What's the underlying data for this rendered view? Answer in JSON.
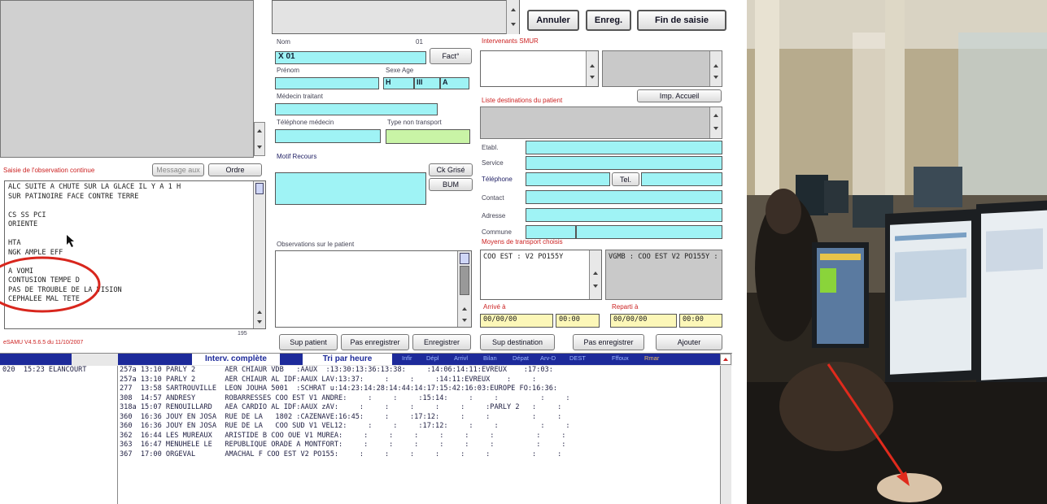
{
  "top_buttons": {
    "cancel": "Annuler",
    "save": "Enreg.",
    "end": "Fin de saisie"
  },
  "patient": {
    "nom_label": "Nom",
    "nom_num": "01",
    "nom_value": "X 01",
    "fact_btn": "Fact°",
    "prenom_label": "Prénom",
    "sexe_age_label": "Sexe Age",
    "sexe": "H",
    "age": "III",
    "age_unit": "A",
    "medecin_label": "Médecin traitant",
    "tel_medecin_label": "Téléphone médecin",
    "transport_label": "Type non transport",
    "motif_label": "Motif Recours",
    "ck_btn": "Ck Grisé",
    "bum_btn": "BUM",
    "obs_label": "Observations sur le patient"
  },
  "observation": {
    "title": "Saisie de l'observation continue",
    "btn_message": "Message aux",
    "btn_ordre": "Ordre",
    "lines": [
      "ALC SUITE A CHUTE SUR LA GLACE IL Y A 1 H",
      "SUR PATINOIRE FACE CONTRE TERRE",
      "",
      "CS SS PCI",
      "ORIENTE",
      "",
      "HTA",
      "NGK AMPLE EFF",
      "",
      "A VOMI",
      "CONTUSION TEMPE D",
      "PAS DE TROUBLE DE LA VISION",
      "CEPHALEE MAL TETE"
    ],
    "counter": "195",
    "version": "eSAMU V4.5.6.5 du 11/10/2007"
  },
  "intervenants": {
    "title": "Intervenants SMUR",
    "dest_title": "Liste destinations du patient",
    "imp_btn": "Imp. Accueil",
    "etabl": "Etabl.",
    "service": "Service",
    "telephone": "Téléphone",
    "tel_btn": "Tel.",
    "contact": "Contact",
    "adresse": "Adresse",
    "commune": "Commune",
    "moyens_title": "Moyens de transport choisis",
    "moyen1": "COO EST : V2 PO155Y",
    "moyen2": "VGMB : COO EST V2 PO155Y :",
    "arrive_label": "Arrivé à",
    "reparti_label": "Reparti à",
    "date1": "00/00/00",
    "time1": "00:00",
    "date2": "00/00/00",
    "time2": "00:00"
  },
  "bottom_buttons": {
    "sup_patient": "Sup patient",
    "pas_enreg": "Pas enregistrer",
    "enreg": "Enregistrer",
    "sup_dest": "Sup destination",
    "pas_enreg2": "Pas enregistrer",
    "ajouter": "Ajouter"
  },
  "table": {
    "tab1": "Interv. complète",
    "tab2": "Tri par heure",
    "headers": [
      "Infir",
      "Dépl",
      "Arrivl",
      "Bilan",
      "Dépat",
      "Arv-D",
      "DEST",
      "Fffoux",
      "Rmar"
    ],
    "left_row": "020  15:23 ELANCOURT",
    "rows": [
      "257a 13:10 PARLY 2       AER CHIAUR VDB   :AAUX  :13:30:13:36:13:38:     :14:06:14:11:EVREUX    :17:03:",
      "257a 13:10 PARLY 2       AER CHIAUR AL IDF:AAUX LAV:13:37:     :     :     :14:11:EVREUX    :     :",
      "277  13:58 SARTROUVILLE  LEON JOUHA 5001  :SCHRAT u:14:23:14:28:14:44:14:17:15:42:16:03:EUROPE FO:16:36:",
      "308  14:57 ANDRESY       ROBARRESSES COO EST V1 ANDRE:     :     :     :15:14:     :     :          :     :",
      "318a 15:07 RENOUILLARD   AEA CARDIO AL IDF:AAUX zAV:     :     :     :     :     :     :PARLY 2   :     :",
      "360  16:36 JOUY EN JOSA  RUE DE LA   1802 :CAZENAVE:16:45:     :     :17:12:     :     :          :     :",
      "360  16:36 JOUY EN JOSA  RUE DE LA   COO SUD V1 VEL12:     :     :     :17:12:     :     :          :     :",
      "362  16:44 LES MUREAUX   ARISTIDE B COO OUE V1 MUREA:     :     :     :     :     :     :          :     :",
      "363  16:47 MENUHELE LE   REPUBLIQUE ORADE A MONTFORT:     :     :     :     :     :     :          :     :",
      "367  17:00 ORGEVAL       AMACHAL F COO EST V2 PO155:     :     :     :     :     :     :          :     :"
    ]
  },
  "colors": {
    "cyan": "#9ff3f5",
    "green": "#c9f4a6",
    "yellow": "#fcf7b8",
    "annotation_red": "#d8261d",
    "label_red": "#c22222"
  }
}
